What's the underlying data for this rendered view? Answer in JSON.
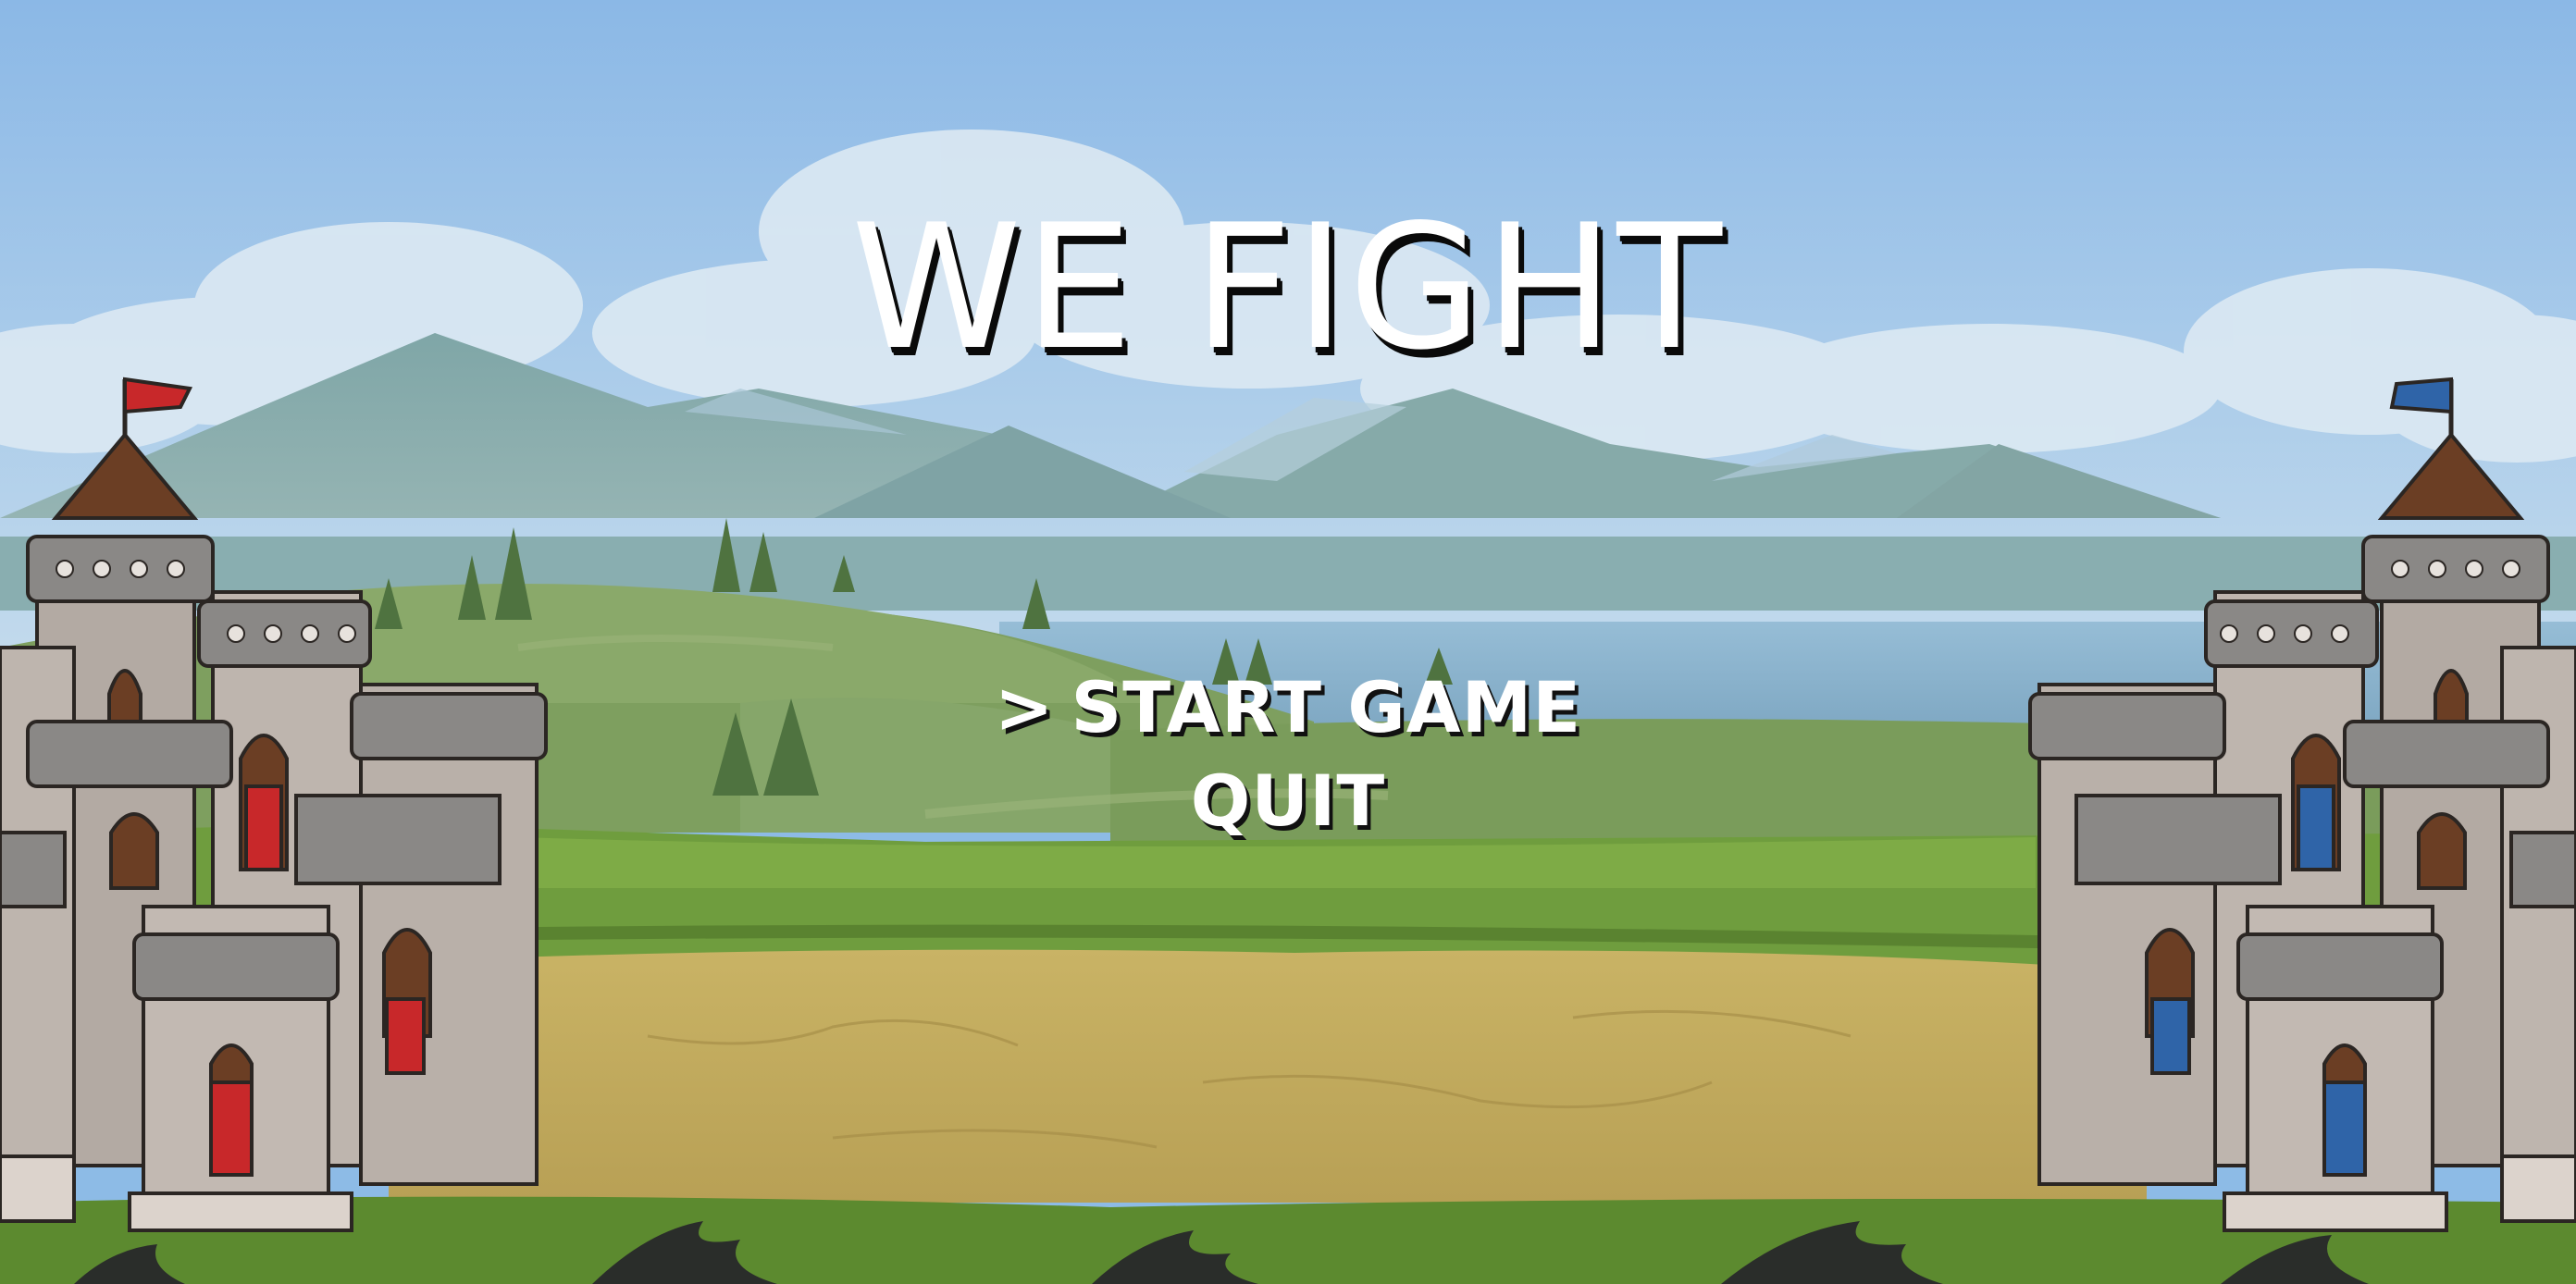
{
  "title": "WE FIGHT",
  "menu": {
    "cursor": ">",
    "items": [
      {
        "label": "START GAME",
        "selected": true
      },
      {
        "label": "QUIT",
        "selected": false
      }
    ]
  },
  "teams": {
    "left": {
      "banner_color": "#c8282a"
    },
    "right": {
      "banner_color": "#2f64a8"
    }
  },
  "palette": {
    "sky": "#8dbbe6",
    "grass": "#6f9d3e",
    "dirt": "#c3ac5c",
    "water": "#8fb6cf"
  }
}
